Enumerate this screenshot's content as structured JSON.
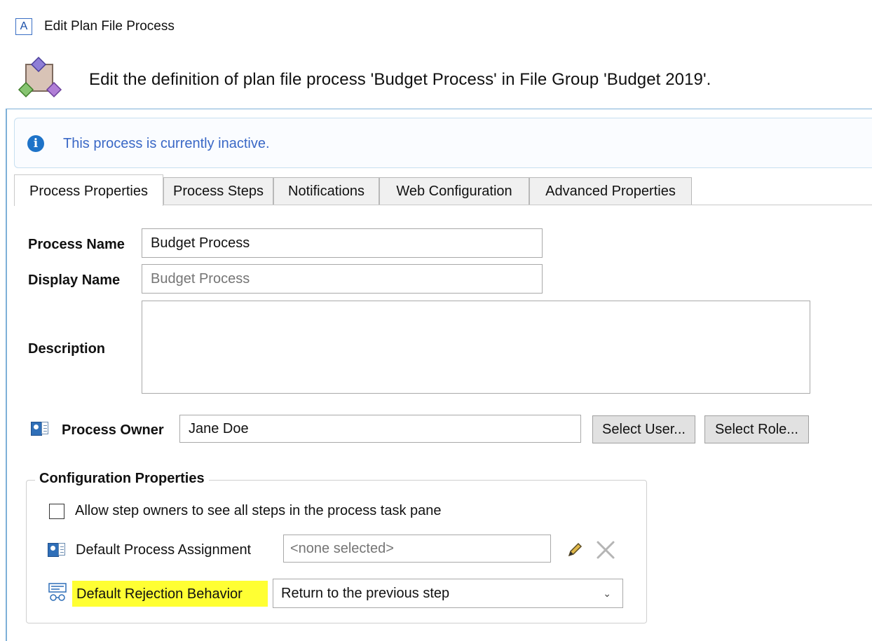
{
  "window": {
    "app_icon_letter": "A",
    "title": "Edit Plan File Process"
  },
  "header": {
    "text": "Edit the definition of plan file process 'Budget Process' in File Group 'Budget 2019'."
  },
  "info": {
    "message": "This process is currently inactive."
  },
  "tabs": [
    {
      "label": "Process Properties",
      "active": true
    },
    {
      "label": "Process Steps",
      "active": false
    },
    {
      "label": "Notifications",
      "active": false
    },
    {
      "label": "Web Configuration",
      "active": false
    },
    {
      "label": "Advanced Properties",
      "active": false
    }
  ],
  "form": {
    "process_name_label": "Process Name",
    "process_name_value": "Budget Process",
    "display_name_label": "Display Name",
    "display_name_placeholder": "Budget Process",
    "description_label": "Description",
    "description_value": "",
    "process_owner_label": "Process Owner",
    "process_owner_value": "Jane Doe",
    "select_user_label": "Select User...",
    "select_role_label": "Select Role..."
  },
  "config": {
    "group_title": "Configuration Properties",
    "allow_steps_label": "Allow step owners to see all steps in the process task pane",
    "allow_steps_checked": false,
    "default_assignment_label": "Default Process Assignment",
    "default_assignment_placeholder": "<none selected>",
    "default_rejection_label": "Default Rejection Behavior",
    "default_rejection_value": "Return to the previous step"
  },
  "colors": {
    "info_text": "#3a68c6",
    "info_icon": "#1e73c8",
    "highlight": "#ffff33",
    "accent_rule": "#7eb0d8"
  }
}
